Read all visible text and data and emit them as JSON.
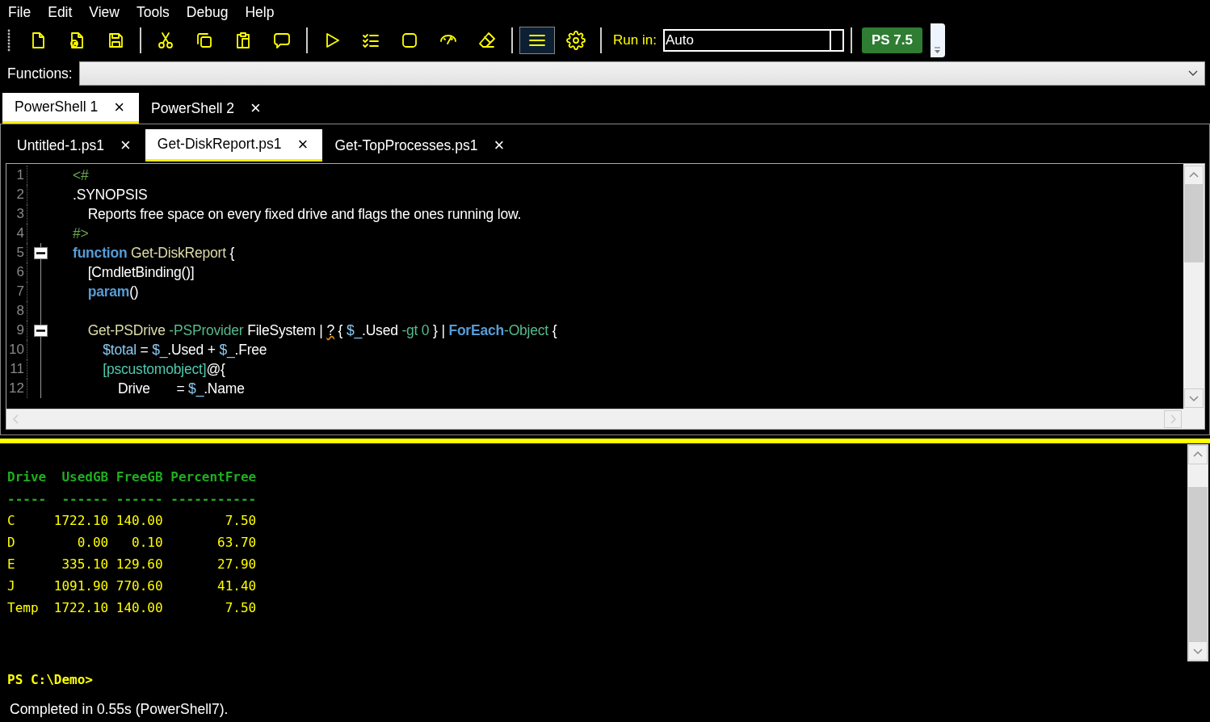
{
  "menu": [
    "File",
    "Edit",
    "View",
    "Tools",
    "Debug",
    "Help"
  ],
  "toolbar": [
    {
      "pressed": false
    },
    {
      "pressed": false
    },
    {
      "pressed": false
    },
    {
      "pressed": false
    },
    {
      "pressed": false
    },
    {
      "pressed": false
    },
    {
      "pressed": false
    },
    {
      "pressed": false
    },
    {
      "pressed": false
    },
    {
      "pressed": false
    },
    {
      "pressed": false
    },
    {
      "pressed": false
    },
    {
      "pressed": true
    },
    {
      "pressed": false
    }
  ],
  "run_in": {
    "label": "Run in:",
    "value": "Auto"
  },
  "version_badge": "PS 7.5",
  "functions": {
    "label": "Functions:"
  },
  "session_tabs": [
    {
      "label": "PowerShell 1",
      "close": "×",
      "selected": true
    },
    {
      "label": "PowerShell 2",
      "close": "×",
      "selected": false
    }
  ],
  "file_tabs": [
    {
      "label": "Untitled-1.ps1",
      "close": "×",
      "selected": false
    },
    {
      "label": "Get-DiskReport.ps1",
      "close": "×",
      "selected": true
    },
    {
      "label": "Get-TopProcesses.ps1",
      "close": "×",
      "selected": false
    }
  ],
  "editor": {
    "lines": [
      {
        "number": "1",
        "tokens": [
          {
            "kind": "comment",
            "text": "<#"
          }
        ]
      },
      {
        "number": "2",
        "tokens": [
          {
            "kind": "text",
            "text": ".SYNOPSIS"
          }
        ]
      },
      {
        "number": "3",
        "tokens": [
          {
            "kind": "text",
            "text": "    Reports free space on every fixed drive and flags the ones running low."
          }
        ]
      },
      {
        "number": "4",
        "tokens": [
          {
            "kind": "comment",
            "text": "#>"
          }
        ]
      },
      {
        "number": "5",
        "collapsed": false,
        "tokens": [
          {
            "kind": "keyword",
            "text": "function"
          },
          {
            "kind": "command",
            "text": " Get-DiskReport"
          },
          {
            "kind": "text",
            "text": " {"
          }
        ]
      },
      {
        "number": "6",
        "tokens": [
          {
            "kind": "text",
            "text": "    [CmdletBinding()]"
          }
        ]
      },
      {
        "number": "7",
        "tokens": [
          {
            "kind": "keyword",
            "text": "    param"
          },
          {
            "kind": "text",
            "text": "()"
          }
        ]
      },
      {
        "number": "8"
      },
      {
        "number": "9",
        "collapsed": false,
        "tokens": [
          {
            "kind": "command",
            "text": "    Get-PSDrive"
          },
          {
            "kind": "parameter",
            "text": " -PSProvider"
          },
          {
            "kind": "text",
            "text": " FileSystem | "
          },
          {
            "kind": "flagged",
            "text": "?"
          },
          {
            "kind": "text",
            "text": " { "
          },
          {
            "kind": "variable",
            "text": "$_"
          },
          {
            "kind": "text",
            "text": ".Used "
          },
          {
            "kind": "parameter",
            "text": "-gt 0"
          },
          {
            "kind": "text",
            "text": " } | "
          },
          {
            "kind": "keyword",
            "text": "ForEach"
          },
          {
            "kind": "parameter",
            "text": "-Object"
          },
          {
            "kind": "text",
            "text": " {"
          }
        ]
      },
      {
        "number": "10",
        "tokens": [
          {
            "kind": "variable",
            "text": "        $total"
          },
          {
            "kind": "text",
            "text": " = "
          },
          {
            "kind": "variable",
            "text": "$_"
          },
          {
            "kind": "text",
            "text": ".Used + "
          },
          {
            "kind": "variable",
            "text": "$_"
          },
          {
            "kind": "text",
            "text": ".Free"
          }
        ]
      },
      {
        "number": "11",
        "tokens": [
          {
            "kind": "type",
            "text": "        [pscustomobject]"
          },
          {
            "kind": "text",
            "text": "@{"
          }
        ]
      },
      {
        "number": "12",
        "tokens": [
          {
            "kind": "text",
            "text": "            Drive       = "
          },
          {
            "kind": "variable",
            "text": "$_"
          },
          {
            "kind": "text",
            "text": ".Name"
          }
        ]
      }
    ]
  },
  "console": {
    "columns": [
      "Drive",
      "UsedGB",
      "FreeGB",
      "PercentFree"
    ],
    "rules": [
      "-----",
      "------",
      "------",
      "-----------"
    ],
    "rows": [
      [
        "C",
        "1722.10",
        "140.00",
        "7.50"
      ],
      [
        "D",
        "0.00",
        "0.10",
        "63.70"
      ],
      [
        "E",
        "335.10",
        "129.60",
        "27.90"
      ],
      [
        "J",
        "1091.90",
        "770.60",
        "41.40"
      ],
      [
        "Temp",
        "1722.10",
        "140.00",
        "7.50"
      ]
    ],
    "prompt": "PS C:\\Demo>"
  },
  "status": "Completed in 0.55s (PowerShell7)."
}
